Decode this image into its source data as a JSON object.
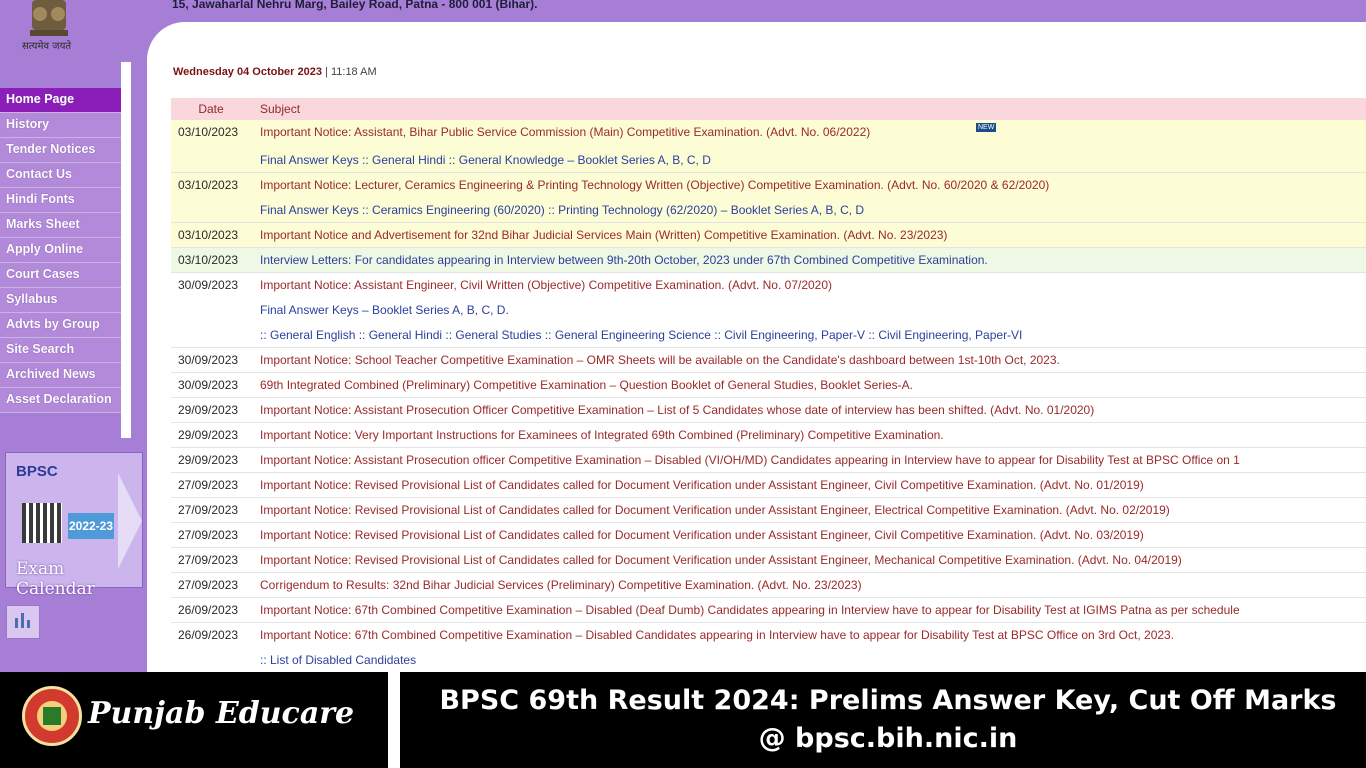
{
  "header": {
    "address": "15, Jawaharlal Nehru Marg, Bailey Road, Patna - 800 001 (Bihar).",
    "emblem_text": "सत्यमेव जयते"
  },
  "sidebar": {
    "items": [
      {
        "label": "Home Page",
        "active": true
      },
      {
        "label": "History"
      },
      {
        "label": "Tender Notices"
      },
      {
        "label": "Contact Us"
      },
      {
        "label": "Hindi Fonts"
      },
      {
        "label": "Marks Sheet"
      },
      {
        "label": "Apply Online"
      },
      {
        "label": "Court Cases"
      },
      {
        "label": "Syllabus"
      },
      {
        "label": "Advts by Group"
      },
      {
        "label": "Site Search"
      },
      {
        "label": "Archived News"
      },
      {
        "label": "Asset Declaration"
      }
    ],
    "calendar": {
      "title": "BPSC",
      "year": "2022-23",
      "label": "Exam Calendar"
    },
    "chart_icon": "bar-chart-icon"
  },
  "main": {
    "date": "Wednesday 04 October 2023",
    "time": "11:18 AM",
    "separator": "|",
    "columns": [
      "Date",
      "Subject"
    ],
    "rows": [
      {
        "date": "03/10/2023",
        "tone": "yellow",
        "lines": [
          "Important Notice: Assistant, Bihar Public Service Commission (Main) Competitive Examination. (Advt. No. 06/2022)",
          "Final Answer Keys :: General Hindi :: General Knowledge – Booklet Series A, B, C, D"
        ],
        "new_badge": "NEW"
      },
      {
        "date": "03/10/2023",
        "tone": "yellow",
        "lines": [
          "Important Notice: Lecturer, Ceramics Engineering & Printing Technology Written (Objective) Competitive Examination. (Advt. No. 60/2020 & 62/2020)",
          "Final Answer Keys :: Ceramics Engineering (60/2020) :: Printing Technology (62/2020) – Booklet Series A, B, C, D"
        ]
      },
      {
        "date": "03/10/2023",
        "tone": "yellow",
        "lines": [
          "Important Notice and Advertisement for 32nd Bihar Judicial Services Main (Written) Competitive Examination. (Advt. No. 23/2023)"
        ]
      },
      {
        "date": "03/10/2023",
        "tone": "green",
        "lines": [
          "Interview Letters: For candidates appearing in Interview between 9th-20th October, 2023 under 67th Combined Competitive Examination."
        ]
      },
      {
        "date": "30/09/2023",
        "tone": "",
        "lines": [
          "Important Notice: Assistant Engineer, Civil Written (Objective) Competitive Examination. (Advt. No. 07/2020)",
          "Final Answer Keys – Booklet Series A, B, C, D.",
          ":: General English :: General Hindi :: General Studies :: General Engineering Science :: Civil Engineering, Paper-V :: Civil Engineering, Paper-VI"
        ]
      },
      {
        "date": "30/09/2023",
        "tone": "",
        "lines": [
          "Important Notice: School Teacher Competitive Examination – OMR Sheets will be available on the Candidate's dashboard between 1st-10th Oct, 2023."
        ]
      },
      {
        "date": "30/09/2023",
        "tone": "",
        "lines": [
          "69th Integrated Combined (Preliminary) Competitive Examination – Question Booklet of General Studies, Booklet Series-A."
        ]
      },
      {
        "date": "29/09/2023",
        "tone": "",
        "lines": [
          "Important Notice: Assistant Prosecution Officer Competitive Examination – List of 5 Candidates whose date of interview has been shifted. (Advt. No. 01/2020)"
        ]
      },
      {
        "date": "29/09/2023",
        "tone": "",
        "lines": [
          "Important Notice: Very Important Instructions for Examinees of Integrated 69th Combined (Preliminary) Competitive Examination."
        ]
      },
      {
        "date": "29/09/2023",
        "tone": "",
        "lines": [
          "Important Notice: Assistant Prosecution officer Competitive Examination – Disabled (VI/OH/MD) Candidates appearing in Interview have to appear for Disability Test at BPSC Office on 1"
        ]
      },
      {
        "date": "27/09/2023",
        "tone": "",
        "lines": [
          "Important Notice: Revised Provisional List of Candidates called for Document Verification under Assistant Engineer, Civil Competitive Examination. (Advt. No. 01/2019)"
        ]
      },
      {
        "date": "27/09/2023",
        "tone": "",
        "lines": [
          "Important Notice: Revised Provisional List of Candidates called for Document Verification under Assistant Engineer, Electrical Competitive Examination. (Advt. No. 02/2019)"
        ]
      },
      {
        "date": "27/09/2023",
        "tone": "",
        "lines": [
          "Important Notice: Revised Provisional List of Candidates called for Document Verification under Assistant Engineer, Civil Competitive Examination. (Advt. No. 03/2019)"
        ]
      },
      {
        "date": "27/09/2023",
        "tone": "",
        "lines": [
          "Important Notice: Revised Provisional List of Candidates called for Document Verification under Assistant Engineer, Mechanical Competitive Examination. (Advt. No. 04/2019)"
        ]
      },
      {
        "date": "27/09/2023",
        "tone": "",
        "lines": [
          "Corrigendum to Results: 32nd Bihar Judicial Services (Preliminary) Competitive Examination. (Advt. No. 23/2023)"
        ]
      },
      {
        "date": "26/09/2023",
        "tone": "",
        "lines": [
          "Important Notice: 67th Combined Competitive Examination – Disabled (Deaf Dumb) Candidates appearing in Interview have to appear for Disability Test at IGIMS Patna as per schedule"
        ]
      },
      {
        "date": "26/09/2023",
        "tone": "",
        "lines": [
          "Important Notice: 67th Combined Competitive Examination – Disabled Candidates appearing in Interview have to appear for Disability Test at BPSC Office on 3rd Oct, 2023.",
          ":: List of Disabled Candidates"
        ]
      }
    ]
  },
  "footer": {
    "brand": "Punjab Educare",
    "headline_line1": "BPSC 69th Result 2024: Prelims Answer Key, Cut Off Marks",
    "headline_line2": "@ bpsc.bih.nic.in",
    "logo_icon": "punjab-educare-logo"
  },
  "colors": {
    "sidebar_bg": "#a77ed6",
    "active_menu": "#8b1db8",
    "table_header": "#f9d7dd",
    "highlight_yellow": "#fcfcd5",
    "highlight_green": "#eef8e4"
  }
}
